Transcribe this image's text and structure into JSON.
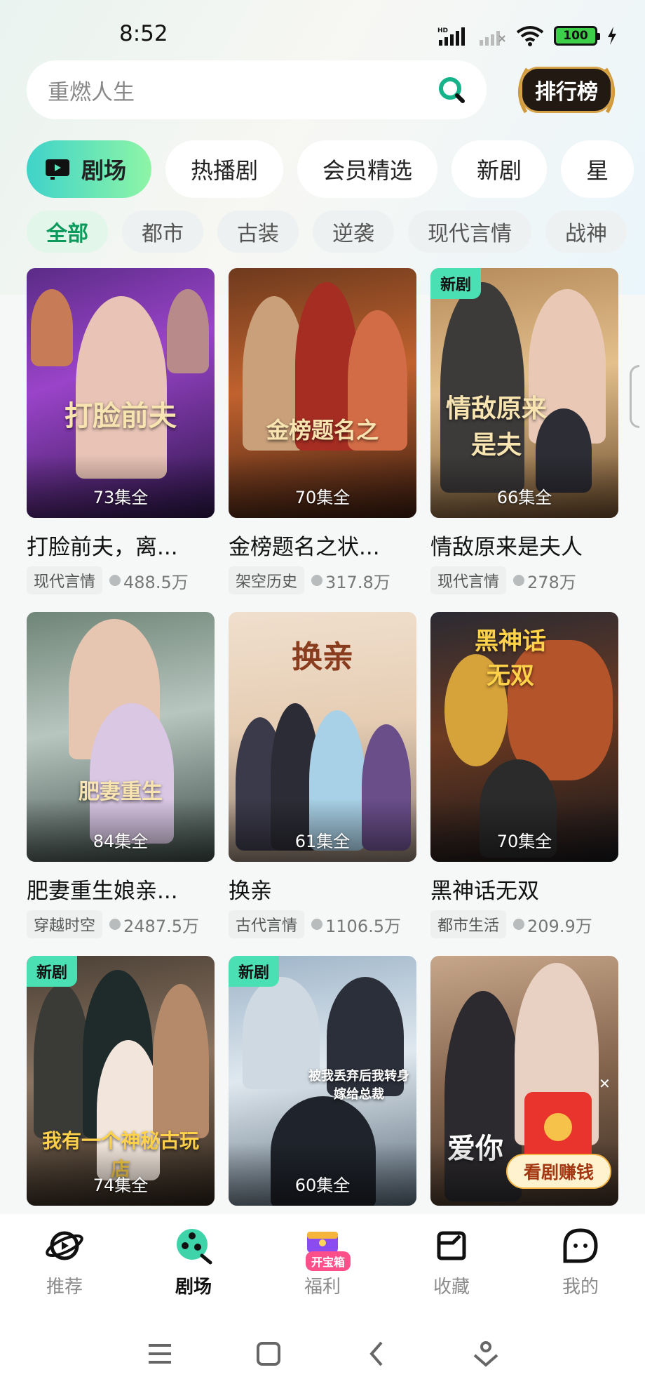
{
  "status_bar": {
    "time": "8:52",
    "battery": "100",
    "network": "HD"
  },
  "search": {
    "placeholder": "重燃人生",
    "rank_label": "排行榜"
  },
  "tabs": [
    {
      "label": "剧场",
      "active": true
    },
    {
      "label": "热播剧",
      "active": false
    },
    {
      "label": "会员精选",
      "active": false
    },
    {
      "label": "新剧",
      "active": false
    },
    {
      "label": "星",
      "active": false
    }
  ],
  "filters": [
    {
      "label": "全部",
      "active": true
    },
    {
      "label": "都市"
    },
    {
      "label": "古装"
    },
    {
      "label": "逆袭"
    },
    {
      "label": "现代言情"
    },
    {
      "label": "战神"
    }
  ],
  "dramas": [
    {
      "title": "打脸前夫，离...",
      "poster_text": "打脸前夫",
      "episodes": "73集全",
      "tag": "现代言情",
      "views": "488.5万",
      "is_new": false
    },
    {
      "title": "金榜题名之状...",
      "poster_text": "金榜题名之",
      "episodes": "70集全",
      "tag": "架空历史",
      "views": "317.8万",
      "is_new": false
    },
    {
      "title": "情敌原来是夫人",
      "poster_text": "情敌原来是夫",
      "episodes": "66集全",
      "tag": "现代言情",
      "views": "278万",
      "is_new": true
    },
    {
      "title": "肥妻重生娘亲...",
      "poster_text": "肥妻重生",
      "episodes": "84集全",
      "tag": "穿越时空",
      "views": "2487.5万",
      "is_new": false
    },
    {
      "title": "换亲",
      "poster_text": "换亲",
      "episodes": "61集全",
      "tag": "古代言情",
      "views": "1106.5万",
      "is_new": false
    },
    {
      "title": "黑神话无双",
      "poster_text": "黑神话无双",
      "episodes": "70集全",
      "tag": "都市生活",
      "views": "209.9万",
      "is_new": false
    },
    {
      "title": "",
      "poster_text": "我有一个神秘古玩店",
      "episodes": "74集全",
      "tag": "",
      "views": "",
      "is_new": true
    },
    {
      "title": "",
      "poster_text": "被我丢弃后我转身嫁给总裁",
      "episodes": "60集全",
      "tag": "",
      "views": "",
      "is_new": true
    },
    {
      "title": "",
      "poster_text": "爱你",
      "episodes": "",
      "tag": "",
      "views": "",
      "is_new": false
    }
  ],
  "new_badge": "新剧",
  "earn": {
    "label": "看剧赚钱"
  },
  "bottom_nav": [
    {
      "label": "推荐",
      "icon": "planet-icon",
      "active": false
    },
    {
      "label": "剧场",
      "icon": "film-reel-icon",
      "active": true
    },
    {
      "label": "福利",
      "icon": "treasure-chest-icon",
      "active": false,
      "badge": "开宝箱"
    },
    {
      "label": "收藏",
      "icon": "folder-icon",
      "active": false
    },
    {
      "label": "我的",
      "icon": "face-icon",
      "active": false
    }
  ],
  "colors": {
    "accent": "#0d9a5c",
    "tab_gradient_start": "#3fd3c9",
    "tab_gradient_end": "#8ef5a6",
    "new_badge": "#4be0b3"
  }
}
